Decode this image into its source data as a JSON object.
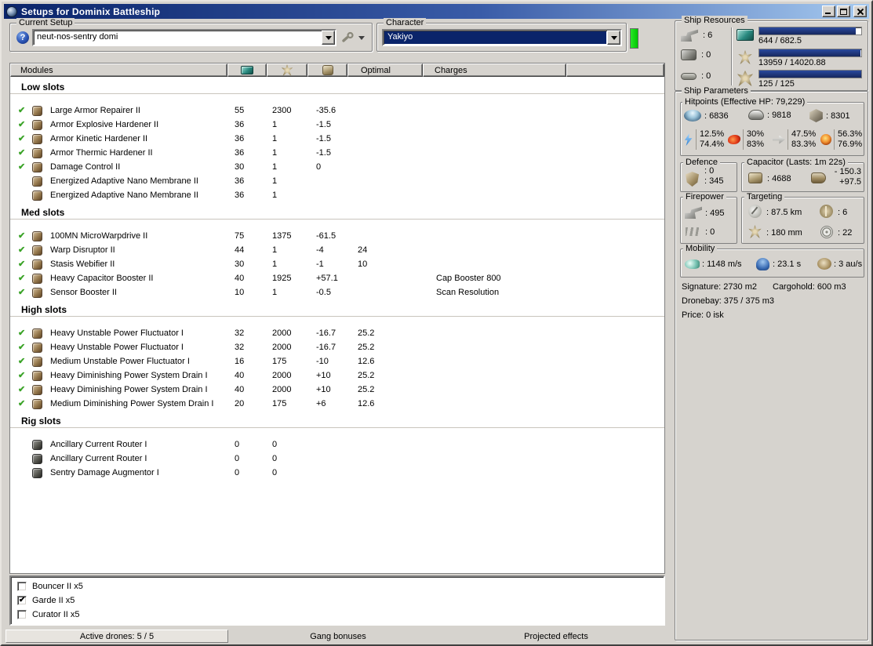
{
  "window": {
    "title": "Setups for Dominix Battleship"
  },
  "colors": {
    "titlebar_start": "#0a246a",
    "titlebar_end": "#a6caf0",
    "selection": "#0a246a",
    "green_indicator": "#00d400",
    "resource_bar": "#1b2f7e",
    "check_green": "#3aa327"
  },
  "current_setup": {
    "label": "Current Setup",
    "value": "neut-nos-sentry domi"
  },
  "character": {
    "label": "Character",
    "value": "Yakiyo"
  },
  "ship_resources": {
    "label": "Ship Resources",
    "hardpoints": [
      {
        "name": "turret-hardpoints",
        "value": ": 6"
      },
      {
        "name": "launcher-hardpoints",
        "value": ": 0"
      },
      {
        "name": "rig-slots",
        "value": ": 0"
      }
    ],
    "bars": [
      {
        "name": "cpu",
        "text": "644 / 682.5",
        "pct": 94.4
      },
      {
        "name": "powergrid",
        "text": "13959 / 14020.88",
        "pct": 99.6
      },
      {
        "name": "drone-bandwidth",
        "text": "125 / 125",
        "pct": 100
      }
    ]
  },
  "ship_parameters": {
    "label": "Ship Parameters",
    "hitpoints": {
      "label": "Hitpoints (Effective HP: 79,229)",
      "shield": ": 6836",
      "armor": ": 9818",
      "hull": ": 8301",
      "resists": [
        {
          "type": "em",
          "top": "12.5%",
          "bottom": "74.4%"
        },
        {
          "type": "explosive",
          "top": "30%",
          "bottom": "83%"
        },
        {
          "type": "kinetic",
          "top": "47.5%",
          "bottom": "83.3%"
        },
        {
          "type": "thermal",
          "top": "56.3%",
          "bottom": "76.9%"
        }
      ]
    },
    "defence": {
      "label": "Defence",
      "top": ": 0",
      "bottom": ": 345"
    },
    "capacitor": {
      "label": "Capacitor (Lasts: 1m 22s)",
      "amount": ": 4688",
      "delta_out": "- 150.3",
      "delta_in": "+97.5"
    },
    "firepower": {
      "label": "Firepower",
      "turret": ": 495",
      "missile": ": 0"
    },
    "targeting": {
      "label": "Targeting",
      "range": ": 87.5 km",
      "max_targets": ": 6",
      "scan_resolution": ": 180 mm",
      "sensor_strength": ": 22"
    },
    "mobility": {
      "label": "Mobility",
      "speed": ": 1148 m/s",
      "align_time": ": 23.1 s",
      "warp_speed": ": 3 au/s"
    },
    "signature": "Signature: 2730 m2",
    "cargohold": "Cargohold: 600 m3",
    "dronebay": "Dronebay: 375 / 375 m3",
    "price": "Price: 0 isk"
  },
  "table": {
    "headers": {
      "modules": "Modules",
      "optimal": "Optimal",
      "charges": "Charges"
    },
    "sections": [
      {
        "title": "Low slots",
        "rig": false,
        "rows": [
          {
            "active": true,
            "name": "Large Armor Repairer II",
            "cpu": "55",
            "pg": "2300",
            "cap": "-35.6",
            "optimal": "",
            "charges": ""
          },
          {
            "active": true,
            "name": "Armor Explosive Hardener II",
            "cpu": "36",
            "pg": "1",
            "cap": "-1.5",
            "optimal": "",
            "charges": ""
          },
          {
            "active": true,
            "name": "Armor Kinetic Hardener II",
            "cpu": "36",
            "pg": "1",
            "cap": "-1.5",
            "optimal": "",
            "charges": ""
          },
          {
            "active": true,
            "name": "Armor Thermic Hardener II",
            "cpu": "36",
            "pg": "1",
            "cap": "-1.5",
            "optimal": "",
            "charges": ""
          },
          {
            "active": true,
            "name": "Damage Control II",
            "cpu": "30",
            "pg": "1",
            "cap": "0",
            "optimal": "",
            "charges": ""
          },
          {
            "active": false,
            "name": "Energized Adaptive Nano Membrane II",
            "cpu": "36",
            "pg": "1",
            "cap": "",
            "optimal": "",
            "charges": ""
          },
          {
            "active": false,
            "name": "Energized Adaptive Nano Membrane II",
            "cpu": "36",
            "pg": "1",
            "cap": "",
            "optimal": "",
            "charges": ""
          }
        ]
      },
      {
        "title": "Med slots",
        "rig": false,
        "rows": [
          {
            "active": true,
            "name": "100MN MicroWarpdrive II",
            "cpu": "75",
            "pg": "1375",
            "cap": "-61.5",
            "optimal": "",
            "charges": ""
          },
          {
            "active": true,
            "name": "Warp Disruptor II",
            "cpu": "44",
            "pg": "1",
            "cap": "-4",
            "optimal": "24",
            "charges": ""
          },
          {
            "active": true,
            "name": "Stasis Webifier II",
            "cpu": "30",
            "pg": "1",
            "cap": "-1",
            "optimal": "10",
            "charges": ""
          },
          {
            "active": true,
            "name": "Heavy Capacitor Booster II",
            "cpu": "40",
            "pg": "1925",
            "cap": "+57.1",
            "optimal": "",
            "charges": "Cap Booster 800"
          },
          {
            "active": true,
            "name": "Sensor Booster II",
            "cpu": "10",
            "pg": "1",
            "cap": "-0.5",
            "optimal": "",
            "charges": "Scan Resolution"
          }
        ]
      },
      {
        "title": "High slots",
        "rig": false,
        "rows": [
          {
            "active": true,
            "name": "Heavy Unstable Power Fluctuator I",
            "cpu": "32",
            "pg": "2000",
            "cap": "-16.7",
            "optimal": "25.2",
            "charges": ""
          },
          {
            "active": true,
            "name": "Heavy Unstable Power Fluctuator I",
            "cpu": "32",
            "pg": "2000",
            "cap": "-16.7",
            "optimal": "25.2",
            "charges": ""
          },
          {
            "active": true,
            "name": "Medium Unstable Power Fluctuator I",
            "cpu": "16",
            "pg": "175",
            "cap": "-10",
            "optimal": "12.6",
            "charges": ""
          },
          {
            "active": true,
            "name": "Heavy Diminishing Power System Drain I",
            "cpu": "40",
            "pg": "2000",
            "cap": "+10",
            "optimal": "25.2",
            "charges": ""
          },
          {
            "active": true,
            "name": "Heavy Diminishing Power System Drain I",
            "cpu": "40",
            "pg": "2000",
            "cap": "+10",
            "optimal": "25.2",
            "charges": ""
          },
          {
            "active": true,
            "name": "Medium Diminishing Power System Drain I",
            "cpu": "20",
            "pg": "175",
            "cap": "+6",
            "optimal": "12.6",
            "charges": ""
          }
        ]
      },
      {
        "title": "Rig slots",
        "rig": true,
        "rows": [
          {
            "active": false,
            "name": "Ancillary Current Router I",
            "cpu": "0",
            "pg": "0",
            "cap": "",
            "optimal": "",
            "charges": ""
          },
          {
            "active": false,
            "name": "Ancillary Current Router I",
            "cpu": "0",
            "pg": "0",
            "cap": "",
            "optimal": "",
            "charges": ""
          },
          {
            "active": false,
            "name": "Sentry Damage Augmentor I",
            "cpu": "0",
            "pg": "0",
            "cap": "",
            "optimal": "",
            "charges": ""
          }
        ]
      }
    ]
  },
  "drones": {
    "items": [
      {
        "checked": false,
        "label": "Bouncer II x5"
      },
      {
        "checked": true,
        "label": "Garde II x5"
      },
      {
        "checked": false,
        "label": "Curator II x5"
      }
    ]
  },
  "statusbar": {
    "active_drones": "Active drones: 5 / 5",
    "gang_bonuses": "Gang bonuses",
    "projected_effects": "Projected effects"
  }
}
